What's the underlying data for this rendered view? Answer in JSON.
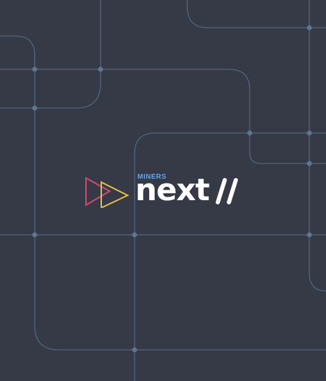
{
  "brand": {
    "small_label": "MINERS",
    "word": "next",
    "colors": {
      "background": "#363a46",
      "lines": "#4f6782",
      "nodes": "#5c7694",
      "accent_blue": "#6aa3e0",
      "triangle_red": "#d64a6e",
      "triangle_yellow": "#e8c24a",
      "text": "#ffffff"
    }
  }
}
